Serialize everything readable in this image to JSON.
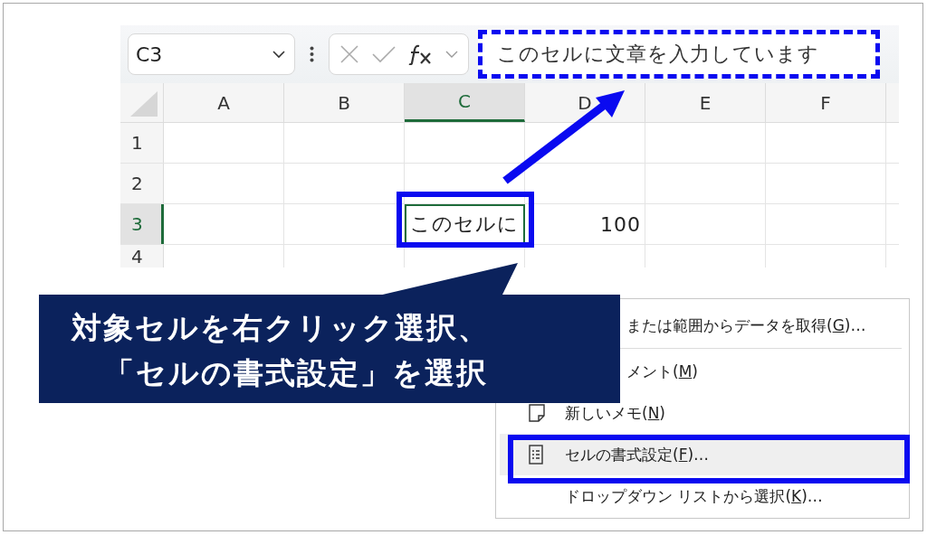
{
  "formula_bar": {
    "name_box": "C3",
    "formula": "このセルに文章を入力しています"
  },
  "columns": [
    {
      "label": "A",
      "selected": false
    },
    {
      "label": "B",
      "selected": false
    },
    {
      "label": "C",
      "selected": true
    },
    {
      "label": "D",
      "selected": false
    },
    {
      "label": "E",
      "selected": false
    },
    {
      "label": "F",
      "selected": false
    }
  ],
  "rows": [
    {
      "label": "1",
      "selected": false,
      "cells": []
    },
    {
      "label": "2",
      "selected": false,
      "cells": []
    },
    {
      "label": "3",
      "selected": true,
      "cells": [
        {},
        {},
        {
          "text": "このセルに",
          "kind": "text",
          "selected": true
        },
        {
          "text": "100",
          "kind": "number"
        },
        {},
        {}
      ]
    },
    {
      "label": "4",
      "selected": false,
      "cells": []
    }
  ],
  "callout": {
    "lines": [
      "対象セルを右クリック選択、",
      "「セルの書式設定」を選択"
    ]
  },
  "context_menu": {
    "items": [
      {
        "kind": "covered",
        "before": "または範囲からデータを取得(",
        "key": "G",
        "after": ")…",
        "selected": false
      },
      {
        "kind": "separator"
      },
      {
        "kind": "covered",
        "before": "メント(",
        "key": "M",
        "after": ")",
        "selected": false
      },
      {
        "kind": "note",
        "before": "新しいメモ(",
        "key": "N",
        "after": ")",
        "selected": false
      },
      {
        "kind": "format",
        "before": "セルの書式設定(",
        "key": "F",
        "after": ")…",
        "selected": true
      },
      {
        "kind": "plain",
        "before": "ドロップダウン リストから選択(",
        "key": "K",
        "after": ")…",
        "selected": false
      }
    ]
  }
}
